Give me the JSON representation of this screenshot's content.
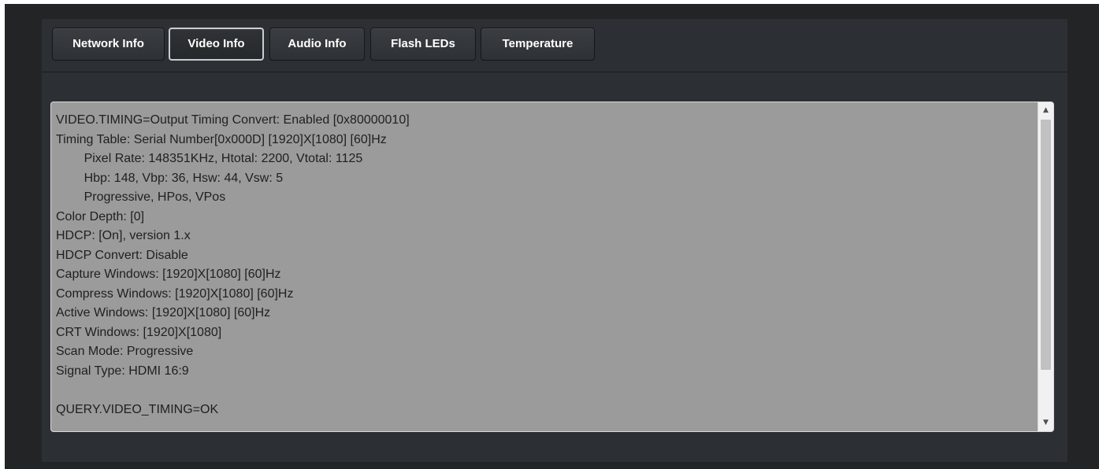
{
  "tabs": {
    "network": "Network Info",
    "video": "Video Info",
    "audio": "Audio Info",
    "flash": "Flash LEDs",
    "temperature": "Temperature",
    "active": "Video Info"
  },
  "output": {
    "text": "VIDEO.TIMING=Output Timing Convert: Enabled [0x80000010]\nTiming Table: Serial Number[0x000D] [1920]X[1080] [60]Hz\n        Pixel Rate: 148351KHz, Htotal: 2200, Vtotal: 1125\n        Hbp: 148, Vbp: 36, Hsw: 44, Vsw: 5\n        Progressive, HPos, VPos\nColor Depth: [0]\nHDCP: [On], version 1.x\nHDCP Convert: Disable\nCapture Windows: [1920]X[1080] [60]Hz\nCompress Windows: [1920]X[1080] [60]Hz\nActive Windows: [1920]X[1080] [60]Hz\nCRT Windows: [1920]X[1080]\nScan Mode: Progressive\nSignal Type: HDMI 16:9\n\nQUERY.VIDEO_TIMING=OK"
  },
  "icons": {
    "scroll_up": "scroll-up-arrow-icon",
    "scroll_down": "scroll-down-arrow-icon"
  },
  "colors": {
    "background": "#222426",
    "panel": "#2c2f33",
    "output_background": "#9b9b9b",
    "tab_text": "#ffffff"
  }
}
